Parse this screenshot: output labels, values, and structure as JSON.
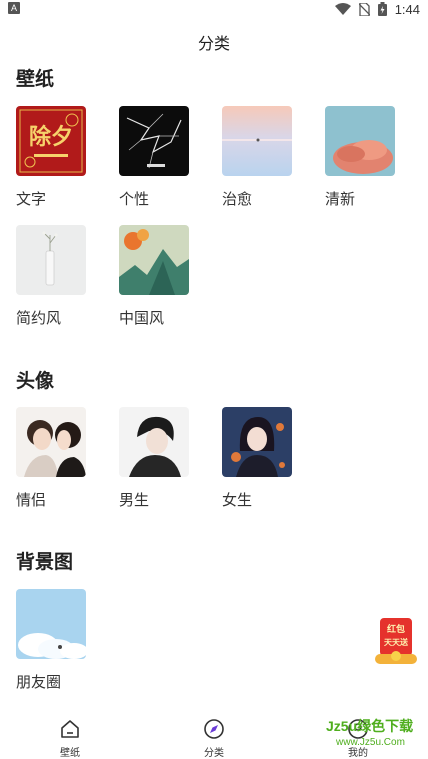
{
  "status_bar": {
    "left_icon": "A",
    "time": "1:44",
    "icons": [
      "wifi-icon",
      "no-sim-icon",
      "battery-icon"
    ]
  },
  "page": {
    "title": "分类"
  },
  "sections": [
    {
      "title": "壁纸",
      "items": [
        {
          "label": "文字",
          "thumb_text": "除夕"
        },
        {
          "label": "个性"
        },
        {
          "label": "治愈"
        },
        {
          "label": "清新"
        },
        {
          "label": "简约风"
        },
        {
          "label": "中国风"
        }
      ]
    },
    {
      "title": "头像",
      "items": [
        {
          "label": "情侣"
        },
        {
          "label": "男生"
        },
        {
          "label": "女生"
        }
      ]
    },
    {
      "title": "背景图",
      "items": [
        {
          "label": "朋友圈"
        }
      ]
    }
  ],
  "float_badge": {
    "line1": "红包",
    "line2": "天天送"
  },
  "tabs": [
    {
      "label": "壁纸",
      "icon": "home-icon"
    },
    {
      "label": "分类",
      "icon": "category-compass-icon",
      "active": true
    },
    {
      "label": "我的",
      "icon": "profile-icon"
    }
  ],
  "watermark": {
    "main": "Jz5u绿色下载",
    "sub": "www.Jz5u.Com"
  },
  "colors": {
    "accent": "#6a3bd6",
    "watermark": "#4fae1e",
    "text": "#222222"
  }
}
